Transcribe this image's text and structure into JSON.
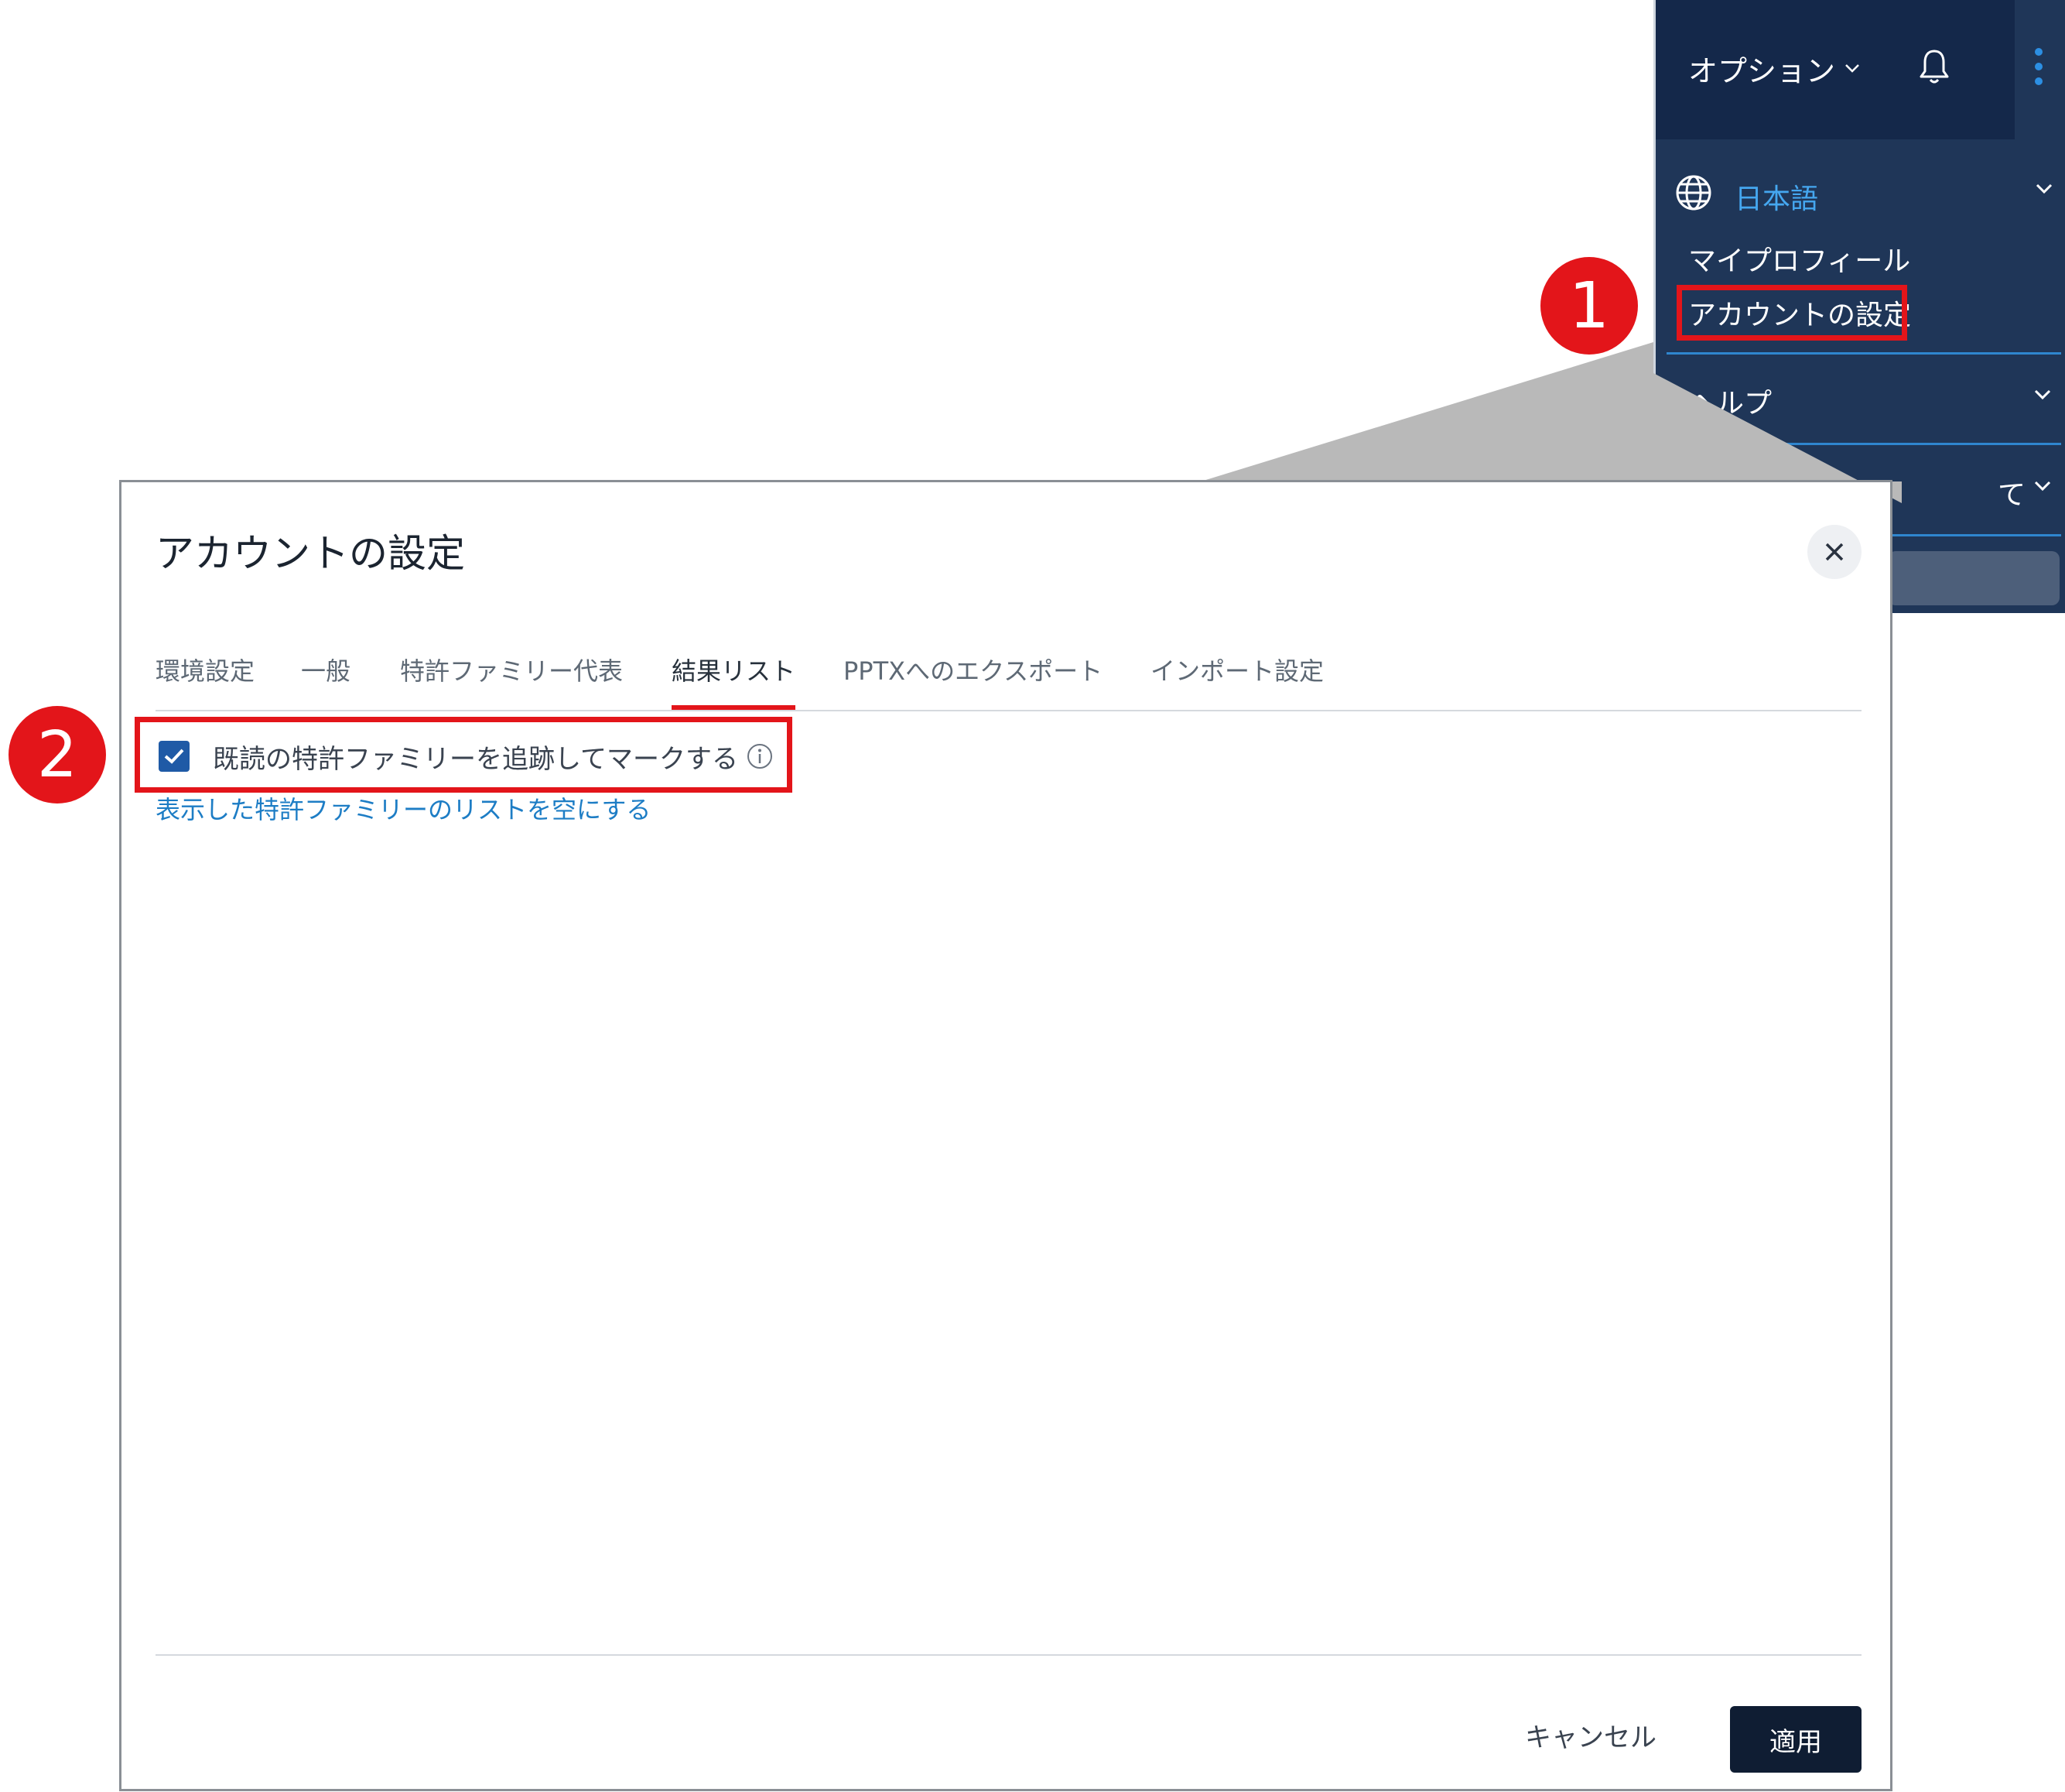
{
  "menu": {
    "options_label": "オプション",
    "language": "日本語",
    "my_profile": "マイプロフィール",
    "account_settings": "アカウントの設定",
    "help": "ヘルプ",
    "about_partial": "て"
  },
  "callouts": {
    "step1": "1",
    "step2": "2"
  },
  "dialog": {
    "title": "アカウントの設定",
    "tabs": [
      {
        "label": "環境設定",
        "active": false
      },
      {
        "label": "一般",
        "active": false
      },
      {
        "label": "特許ファミリー代表",
        "active": false
      },
      {
        "label": "結果リスト",
        "active": true
      },
      {
        "label": "PPTXへのエクスポート",
        "active": false
      },
      {
        "label": "インポート設定",
        "active": false
      }
    ],
    "track_read_label": "既読の特許ファミリーを追跡してマークする",
    "track_read_checked": true,
    "clear_list_link": "表示した特許ファミリーのリストを空にする",
    "cancel": "キャンセル",
    "apply": "適用"
  },
  "colors": {
    "menu_background": "#1f3658",
    "accent_blue": "#45a7f0",
    "highlight_red": "#e3151a",
    "primary_button": "#0f1d33",
    "checkbox": "#1f5aa6",
    "link": "#1d7dc5"
  }
}
